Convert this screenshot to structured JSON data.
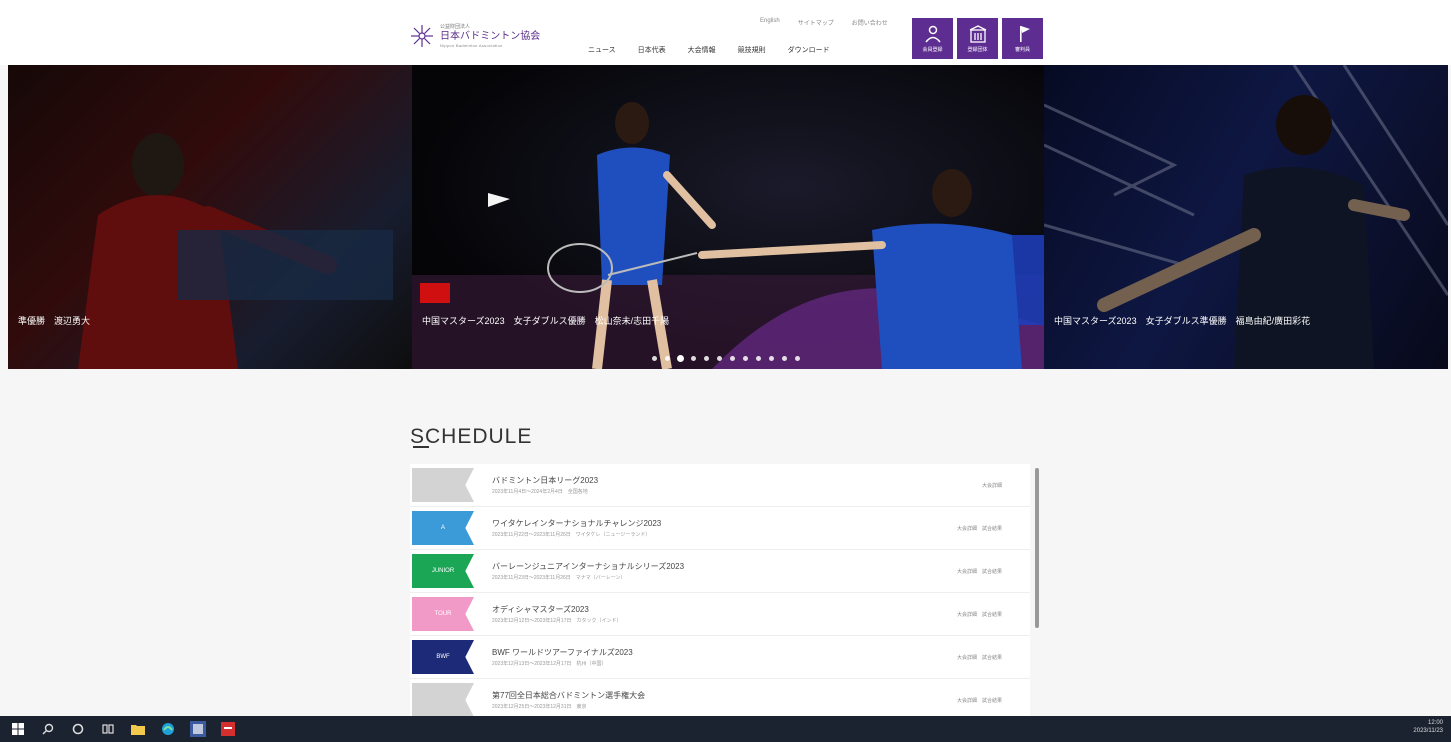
{
  "header": {
    "logo": {
      "org_type": "公益財団法人",
      "name": "日本バドミントン協会",
      "en": "Nippon Badminton Association"
    },
    "util_links": [
      "English",
      "サイトマップ",
      "お問い合わせ"
    ],
    "nav": [
      "ニュース",
      "日本代表",
      "大会情報",
      "競技規則",
      "ダウンロード"
    ],
    "icon_buttons": [
      {
        "label": "会員登録",
        "icon": "person-icon"
      },
      {
        "label": "登録団体",
        "icon": "building-icon"
      },
      {
        "label": "審判員",
        "icon": "flag-icon"
      }
    ]
  },
  "hero": {
    "slides": [
      {
        "caption": "準優勝　渡辺勇大"
      },
      {
        "caption": "中国マスターズ2023　女子ダブルス優勝　松山奈未/志田千陽"
      },
      {
        "caption": "中国マスターズ2023　女子ダブルス準優勝　福島由紀/廣田彩花"
      }
    ],
    "dot_count": 12,
    "active_dot": 2
  },
  "schedule": {
    "title": "SCHEDULE",
    "rows": [
      {
        "tag": "",
        "tag_color": "#d3d3d3",
        "title": "バドミントン日本リーグ2023",
        "sub": "2023年11月4日〜2024年2月4日　全国各地",
        "links": "大会詳細"
      },
      {
        "tag": "A",
        "tag_color": "#3a9bd8",
        "title": "ワイタケレインターナショナルチャレンジ2023",
        "sub": "2023年11月22日〜2023年11月26日　ワイタケレ（ニュージーランド）",
        "links": "大会詳細　試合結果"
      },
      {
        "tag": "JUNIOR",
        "tag_color": "#1aa655",
        "title": "バーレーンジュニアインターナショナルシリーズ2023",
        "sub": "2023年11月23日〜2023年11月26日　マナマ（バーレーン）",
        "links": "大会詳細　試合結果"
      },
      {
        "tag": "TOUR",
        "tag_color": "#f29ac7",
        "title": "オディシャマスターズ2023",
        "sub": "2023年12月12日〜2023年12月17日　カタック（インド）",
        "links": "大会詳細　試合結果"
      },
      {
        "tag": "BWF",
        "tag_color": "#1d2a78",
        "title": "BWF ワールドツアーファイナルズ2023",
        "sub": "2023年12月13日〜2023年12月17日　杭州（中国）",
        "links": "大会詳細　試合結果"
      },
      {
        "tag": "",
        "tag_color": "#d3d3d3",
        "title": "第77回全日本総合バドミントン選手権大会",
        "sub": "2023年12月25日〜2023年12月31日　東京",
        "links": "大会詳細　試合結果"
      }
    ]
  },
  "taskbar": {
    "icons": [
      "windows-start-icon",
      "search-icon",
      "cortana-icon",
      "task-view-icon",
      "file-explorer-icon",
      "edge-icon",
      "app-icon",
      "pdf-icon"
    ],
    "time": "12:00",
    "date": "2023/11/23"
  }
}
